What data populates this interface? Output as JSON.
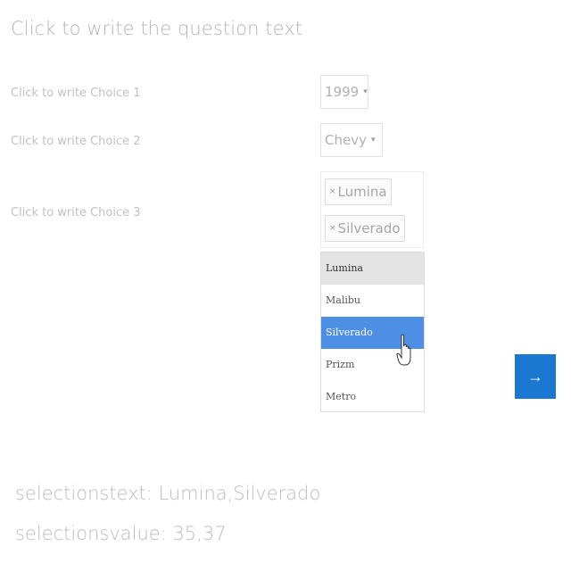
{
  "question": {
    "text": "Click to write the question text"
  },
  "choices": [
    {
      "label": "Click to write Choice 1"
    },
    {
      "label": "Click to write Choice 2"
    },
    {
      "label": "Click to write Choice 3"
    }
  ],
  "year_select": {
    "value": "1999",
    "caret": "▾"
  },
  "make_select": {
    "value": "Chevy",
    "caret": "▾"
  },
  "model_multiselect": {
    "tags": [
      {
        "remove": "×",
        "label": "Lumina"
      },
      {
        "remove": "×",
        "label": "Silverado"
      }
    ],
    "options": [
      {
        "label": "Lumina"
      },
      {
        "label": "Malibu"
      },
      {
        "label": "Silverado"
      },
      {
        "label": "Prizm"
      },
      {
        "label": "Metro"
      }
    ]
  },
  "next_button": {
    "label": "→"
  },
  "results": {
    "selectionstext": "selectionstext: Lumina,Silverado",
    "selectionsvalue": "selectionsvalue: 35,37"
  },
  "colors": {
    "accent": "#1a78d0",
    "highlight": "#4e8fe6"
  }
}
